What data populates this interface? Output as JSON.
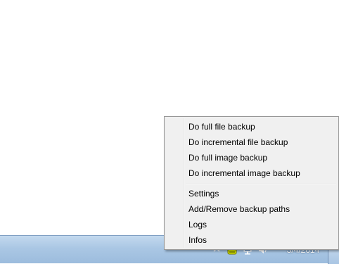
{
  "context_menu": {
    "items": [
      {
        "label": "Do full file backup"
      },
      {
        "label": "Do incremental file backup"
      },
      {
        "label": "Do full image backup"
      },
      {
        "label": "Do incremental image backup"
      },
      {
        "label": "Settings"
      },
      {
        "label": "Add/Remove backup paths"
      },
      {
        "label": "Logs"
      },
      {
        "label": "Infos"
      }
    ]
  },
  "taskbar": {
    "clock_date": "3/4/2014",
    "tray_icons": [
      "backup-app-icon",
      "network-icon",
      "volume-icon"
    ]
  },
  "colors": {
    "menu_background": "#f0f0f0",
    "taskbar": "#a9c5e3",
    "backup_icon": "#d8e600"
  }
}
